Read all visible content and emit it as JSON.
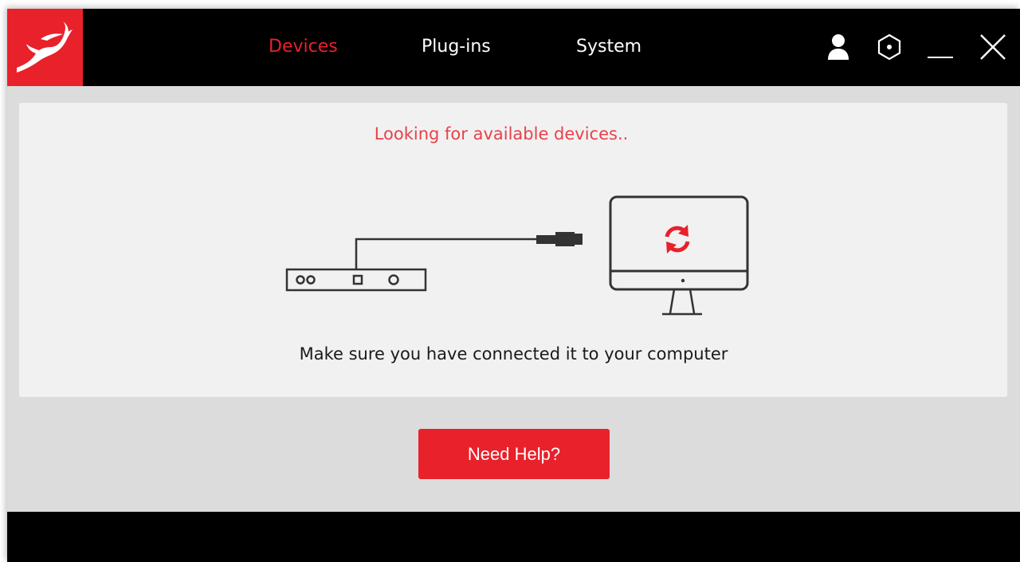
{
  "header": {
    "logo_icon": "antelope-logo-icon",
    "tabs": [
      {
        "label": "Devices",
        "active": true
      },
      {
        "label": "Plug-ins",
        "active": false
      },
      {
        "label": "System",
        "active": false
      }
    ],
    "controls": {
      "user_icon": "user-icon",
      "settings_icon": "hexagon-settings-icon",
      "minimize_icon": "minimize-icon",
      "close_icon": "close-icon"
    }
  },
  "main": {
    "status_text": "Looking for available devices..",
    "illustration_icons": [
      "audio-interface-icon",
      "usb-cable-icon",
      "computer-monitor-icon",
      "refresh-icon"
    ],
    "hint_text": "Make sure you have connected it to your computer",
    "help_button_label": "Need Help?"
  },
  "colors": {
    "accent": "#e8212b",
    "titlebar": "#000000",
    "panel": "#f1f1f1",
    "background": "#dcdcdc"
  }
}
